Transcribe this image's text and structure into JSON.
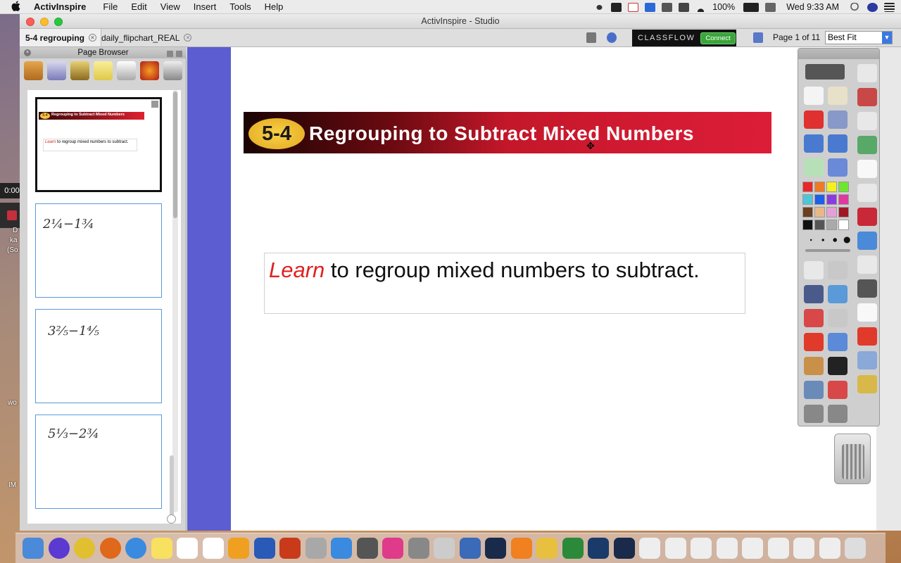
{
  "menubar": {
    "apple": "",
    "app_name": "ActivInspire",
    "items": [
      "File",
      "Edit",
      "View",
      "Insert",
      "Tools",
      "Help"
    ],
    "battery": "100%",
    "clock": "Wed 9:33 AM"
  },
  "desktop": {
    "recording_time": "0:00",
    "left_label_1": "D",
    "left_label_2": "ka",
    "left_label_3": "(So",
    "left_label_4": "wo",
    "left_label_5": "IM"
  },
  "window": {
    "title": "ActivInspire - Studio",
    "tabs": [
      {
        "label": "5-4 regrouping",
        "active": true
      },
      {
        "label": "daily_flipchart_REAL",
        "active": false
      }
    ],
    "classflow": {
      "brand": "CLASSFLOW",
      "connect": "Connect"
    },
    "page_indicator": "Page 1 of 11",
    "zoom": "Best Fit"
  },
  "page_browser": {
    "title": "Page Browser",
    "thumbnails": [
      {
        "id": "page-1",
        "header": "Regrouping to Subtract Mixed Numbers",
        "badge": "5-4",
        "text_em": "Learn",
        "text": " to regroup mixed numbers to subtract."
      },
      {
        "id": "page-2",
        "expression": "2¼−1¾"
      },
      {
        "id": "page-3",
        "expression": "3⅖−1⅘"
      },
      {
        "id": "page-4",
        "expression": "5⅓−2¾"
      }
    ]
  },
  "slide": {
    "badge": "5-4",
    "title": "Regrouping to Subtract Mixed Numbers",
    "goal_highlight": "Learn",
    "goal_text": " to regroup mixed numbers to subtract."
  },
  "toolbox": {
    "colors": [
      "#e8272a",
      "#f07a22",
      "#f5f020",
      "#6ce62e",
      "#4ec6d8",
      "#1e5fe6",
      "#8a3be0",
      "#e0389e",
      "#6a4020",
      "#e8b88a",
      "#e6a0d8",
      "#a01828",
      "#111111",
      "#555555",
      "#aaaaaa",
      "#ffffff"
    ]
  }
}
